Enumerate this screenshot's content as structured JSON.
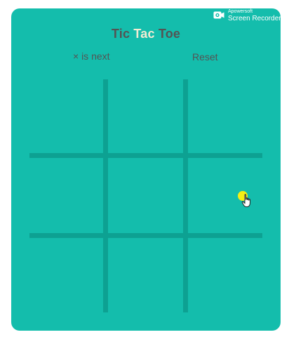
{
  "title": {
    "part1": "Tic",
    "part2": "Tac",
    "part3": "Toe"
  },
  "status": "× is next",
  "reset_label": "Reset",
  "board": [
    "",
    "",
    "",
    "",
    "",
    "",
    "",
    "",
    ""
  ],
  "colors": {
    "background": "#14bdac",
    "grid_lines": "#0da192",
    "title_dark": "#545454",
    "title_accent": "#f2ebd3",
    "cursor_highlight": "#f5ef14"
  },
  "watermark": {
    "small": "Apowersoft",
    "big": "Screen Recorder",
    "icon": "camera-icon"
  }
}
